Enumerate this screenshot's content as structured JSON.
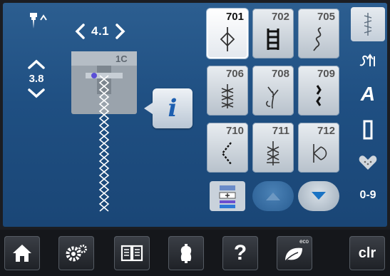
{
  "settings": {
    "width_value": "4.1",
    "length_value": "3.8",
    "foot_number": "1C"
  },
  "stitches": [
    {
      "number": "701",
      "selected": true
    },
    {
      "number": "702",
      "selected": false
    },
    {
      "number": "705",
      "selected": false
    },
    {
      "number": "706",
      "selected": false
    },
    {
      "number": "708",
      "selected": false
    },
    {
      "number": "709",
      "selected": false
    },
    {
      "number": "710",
      "selected": false
    },
    {
      "number": "711",
      "selected": false
    },
    {
      "number": "712",
      "selected": false
    }
  ],
  "info_button": {
    "glyph": "i"
  },
  "right_rail": {
    "alphabet_label": "A",
    "numbers_label": "0-9"
  },
  "bottom_bar": {
    "eco_label": "eco",
    "clr_label": "clr",
    "help_label": "?"
  },
  "colors": {
    "screen_blue": "#1f4f82",
    "tile_light": "#e9edf1",
    "info_blue": "#1d5fb0",
    "scroll_blue": "#1a73c4",
    "rail_purple": "#6b4fd0",
    "bottom_bar": "#15171b"
  }
}
